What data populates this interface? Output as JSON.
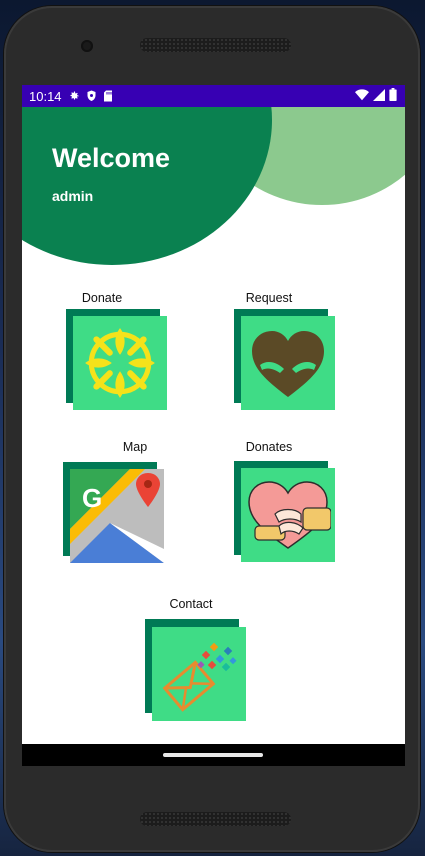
{
  "status_bar": {
    "time": "10:14",
    "icons_left": [
      "settings-gear-icon",
      "shield-icon",
      "sd-card-icon"
    ],
    "icons_right": [
      "wifi-icon",
      "signal-icon",
      "battery-icon"
    ],
    "background": "#3700b3"
  },
  "header": {
    "title": "Welcome",
    "username": "admin",
    "colors": {
      "dark_green": "#0a8150",
      "light_green": "#8cc98e"
    }
  },
  "menu": {
    "tile_color": "#3fdc86",
    "tile_shadow_color": "#007a55",
    "items": [
      {
        "label": "Donate",
        "icon": "hands-circle-icon"
      },
      {
        "label": "Request",
        "icon": "heart-hands-icon"
      },
      {
        "label": "Map",
        "icon": "google-maps-icon"
      },
      {
        "label": "Donates",
        "icon": "heart-hug-icon"
      },
      {
        "label": "Contact",
        "icon": "envelope-pixels-icon"
      }
    ]
  }
}
